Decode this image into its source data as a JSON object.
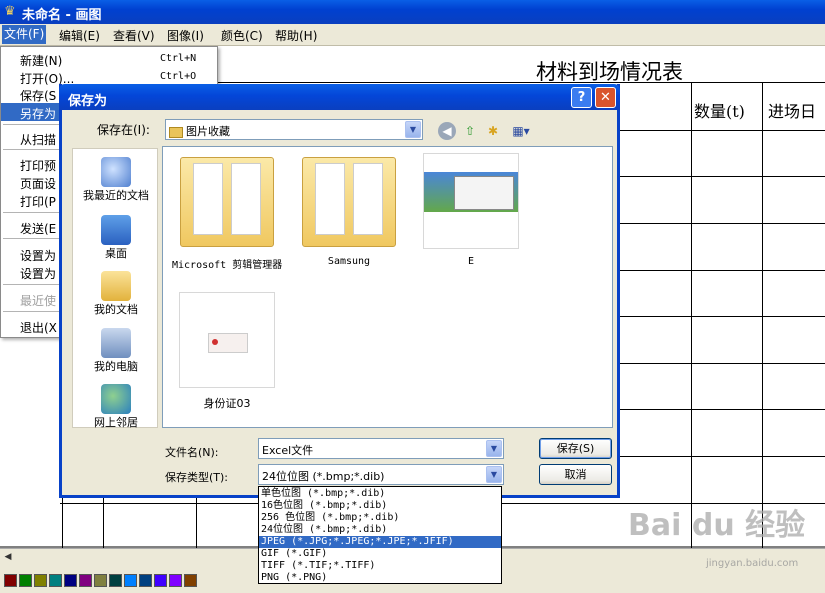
{
  "window": {
    "title": "未命名 - 画图",
    "app_icon": "paint-icon"
  },
  "menubar": [
    "文件(F)",
    "编辑(E)",
    "查看(V)",
    "图像(I)",
    "颜色(C)",
    "帮助(H)"
  ],
  "file_menu": {
    "items": [
      {
        "label": "新建(N)",
        "shortcut": "Ctrl+N"
      },
      {
        "label": "打开(O)...",
        "shortcut": "Ctrl+O"
      },
      {
        "label": "保存(S",
        "shortcut": ""
      },
      {
        "label": "另存为",
        "shortcut": ""
      },
      {
        "label": "从扫描",
        "shortcut": ""
      },
      {
        "label": "打印预",
        "shortcut": ""
      },
      {
        "label": "页面设",
        "shortcut": ""
      },
      {
        "label": "打印(P",
        "shortcut": ""
      },
      {
        "label": "发送(E",
        "shortcut": ""
      },
      {
        "label": "设置为",
        "shortcut": ""
      },
      {
        "label": "设置为",
        "shortcut": ""
      },
      {
        "label": "最近使",
        "shortcut": ""
      },
      {
        "label": "退出(X",
        "shortcut": ""
      }
    ]
  },
  "canvas": {
    "sheet_title": "材料到场情况表",
    "col_headers": [
      "数量(t)",
      "进场日"
    ]
  },
  "dialog": {
    "title": "保存为",
    "help_label": "?",
    "close_label": "✕",
    "save_in_label": "保存在(I):",
    "save_in_value": "图片收藏",
    "places": [
      "我最近的文档",
      "桌面",
      "我的文档",
      "我的电脑",
      "网上邻居"
    ],
    "files": [
      "Microsoft 剪辑管理器",
      "Samsung",
      "E",
      "身份证03"
    ],
    "filename_label": "文件名(N):",
    "filename_value": "Excel文件",
    "filetype_label": "保存类型(T):",
    "filetype_value": "24位位图 (*.bmp;*.dib)",
    "save_button": "保存(S)",
    "cancel_button": "取消",
    "type_options": [
      "单色位图 (*.bmp;*.dib)",
      "16色位图 (*.bmp;*.dib)",
      "256 色位图 (*.bmp;*.dib)",
      "24位位图 (*.bmp;*.dib)",
      "JPEG (*.JPG;*.JPEG;*.JPE;*.JFIF)",
      "GIF (*.GIF)",
      "TIFF (*.TIF;*.TIFF)",
      "PNG (*.PNG)"
    ],
    "selected_type_index": 4
  },
  "watermark": {
    "brand": "Bai du 经验",
    "url": "jingyan.baidu.com"
  },
  "palette": [
    "#800000",
    "#008000",
    "#808000",
    "#008080",
    "#000080",
    "#800080",
    "#808040",
    "#004040",
    "#0080ff",
    "#004080",
    "#4000ff",
    "#8000ff",
    "#804000"
  ],
  "colors": {
    "menu_highlight": "#316ac5",
    "titlebar": "#0a4fd8"
  }
}
